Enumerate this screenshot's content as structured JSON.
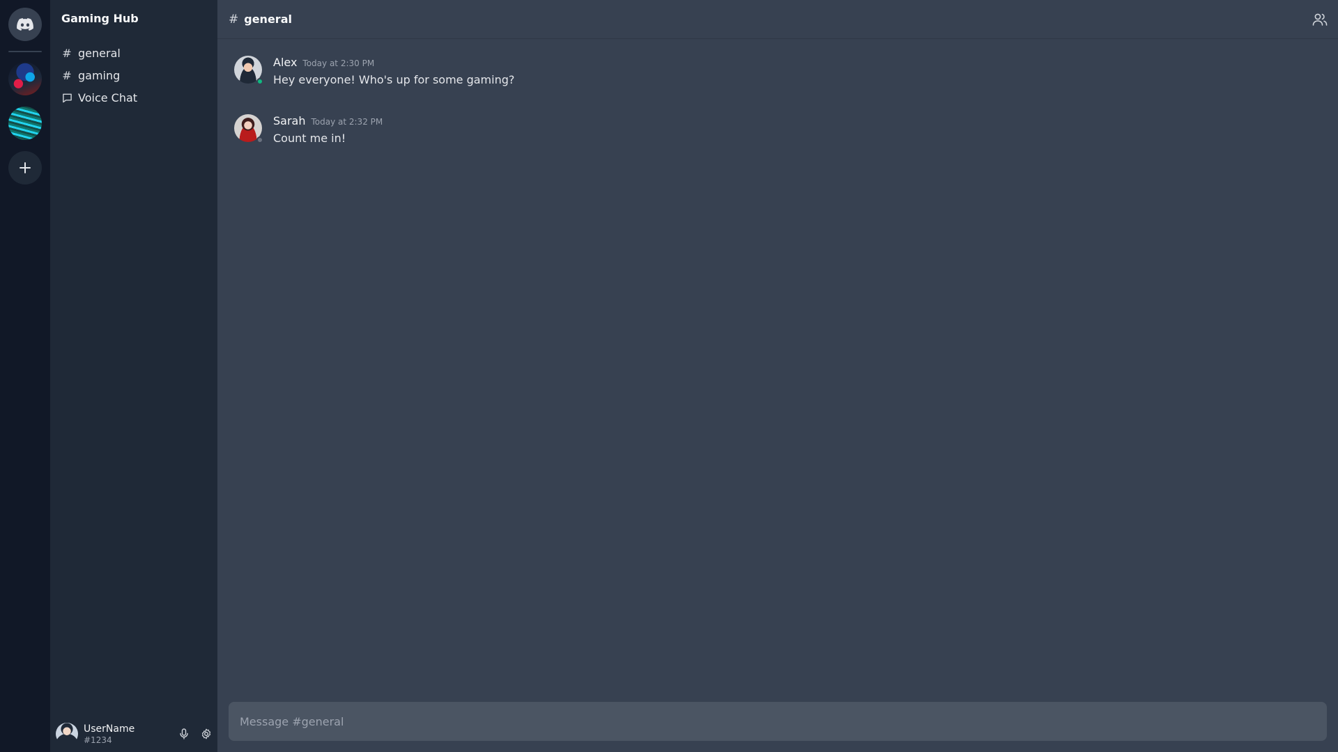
{
  "servers": {
    "home_icon": "discord-icon",
    "items": [
      {
        "name": "server-1",
        "icon": "server-avatar"
      },
      {
        "name": "server-2",
        "icon": "server-avatar"
      }
    ],
    "add_icon": "plus-icon"
  },
  "sidebar": {
    "server_name": "Gaming Hub",
    "channels": [
      {
        "icon": "#",
        "label": "general",
        "type": "text"
      },
      {
        "icon": "#",
        "label": "gaming",
        "type": "text"
      },
      {
        "icon": "chat-bubble-icon",
        "label": "Voice Chat",
        "type": "voice"
      }
    ],
    "user": {
      "name": "UserName",
      "tag": "#1234"
    }
  },
  "header": {
    "hash": "#",
    "channel_name": "general",
    "members_icon": "users-icon"
  },
  "messages": [
    {
      "author": "Alex",
      "time": "Today at 2:30 PM",
      "text": "Hey everyone! Who's up for some gaming?",
      "status": "online",
      "status_color": "#10b981"
    },
    {
      "author": "Sarah",
      "time": "Today at 2:32 PM",
      "text": "Count me in!",
      "status": "offline",
      "status_color": "#6b7280"
    }
  ],
  "composer": {
    "placeholder": "Message #general"
  },
  "colors": {
    "rail_bg": "#111827",
    "sidebar_bg": "#1f2937",
    "main_bg": "#374151",
    "composer_bg": "#4b5563",
    "online": "#10b981"
  }
}
